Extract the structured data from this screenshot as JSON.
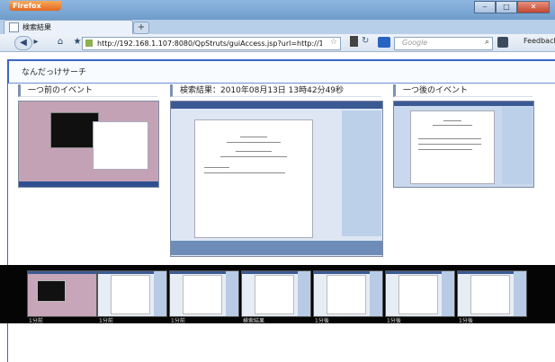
{
  "browser": {
    "app_button": "Firefox",
    "tab_title": "検索結果",
    "new_tab": "+",
    "url": "http://192.168.1.107:8080/QpStruts/guiAccess.jsp?url=http://192.168.1.107/data/",
    "search_placeholder": "Google",
    "feedback_label": "Feedback",
    "window_buttons": {
      "minimize": "‒",
      "maximize": "□",
      "close": "✕"
    }
  },
  "page": {
    "title": "なんだっけサーチ",
    "prev_caption": "一つ前のイベント",
    "main_caption": "検索結果：2010年08月13日 13時42分49秒",
    "next_caption": "一つ後のイベント"
  },
  "filmstrip": {
    "thumbnails": [
      {
        "label": "1分前"
      },
      {
        "label": "1分前"
      },
      {
        "label": "1分前"
      },
      {
        "label": "検索結果"
      },
      {
        "label": "1分後"
      },
      {
        "label": "1分後"
      },
      {
        "label": "1分後"
      }
    ]
  },
  "colors": {
    "accent": "#3a66c8",
    "filmstrip_bg": "#050505"
  }
}
